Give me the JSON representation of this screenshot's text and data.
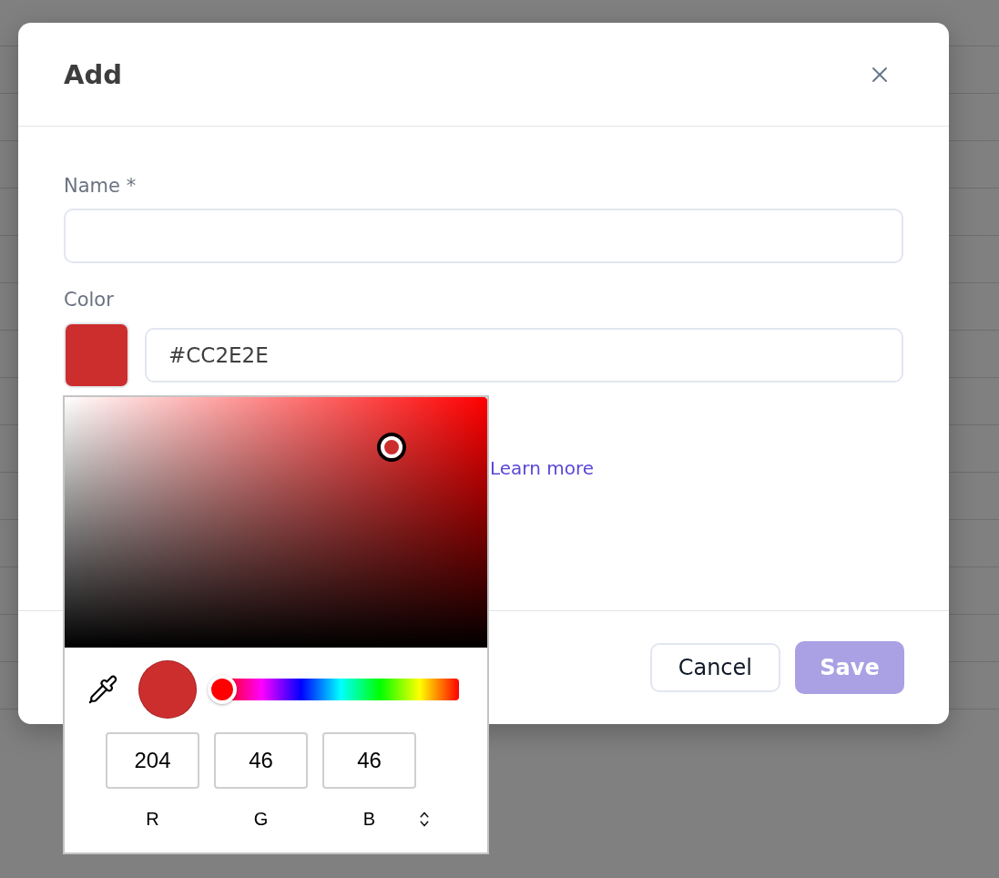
{
  "dialog": {
    "title": "Add"
  },
  "form": {
    "name_field": {
      "label": "Name *"
    },
    "color_field": {
      "label": "Color",
      "swatch": {
        "color": "#cc2e2e"
      },
      "value": "#CC2E2E"
    },
    "help_link": "Learn more"
  },
  "color_picker": {
    "preview": {
      "color": "#cc2e2e"
    },
    "hue_slider": {
      "level": 0
    },
    "channels": [
      {
        "label": "R",
        "value": "204"
      },
      {
        "label": "G",
        "value": "46"
      },
      {
        "label": "B",
        "value": "46"
      }
    ]
  },
  "buttons": [
    {
      "label": "Cancel",
      "kind": "secondary",
      "disabled": false
    },
    {
      "label": "Save",
      "kind": "primary",
      "disabled": true
    }
  ]
}
